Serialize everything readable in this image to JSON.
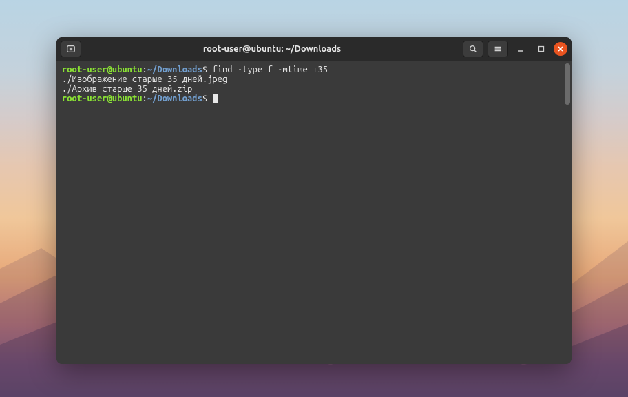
{
  "titlebar": {
    "title": "root-user@ubuntu: ~/Downloads",
    "icons": {
      "new_tab": "new-tab-icon",
      "search": "search-icon",
      "menu": "hamburger-icon",
      "minimize": "minimize-icon",
      "maximize": "maximize-icon",
      "close": "close-icon"
    }
  },
  "prompt": {
    "user_host": "root-user@ubuntu",
    "colon": ":",
    "path": "~/Downloads",
    "symbol": "$"
  },
  "lines": {
    "0": {
      "command": " find -type f -mtime +35"
    },
    "1": {
      "text": "./Изображение старше 35 дней.jpeg"
    },
    "2": {
      "text": "./Архив старше 35 дней.zip"
    },
    "3": {
      "command": " "
    }
  }
}
